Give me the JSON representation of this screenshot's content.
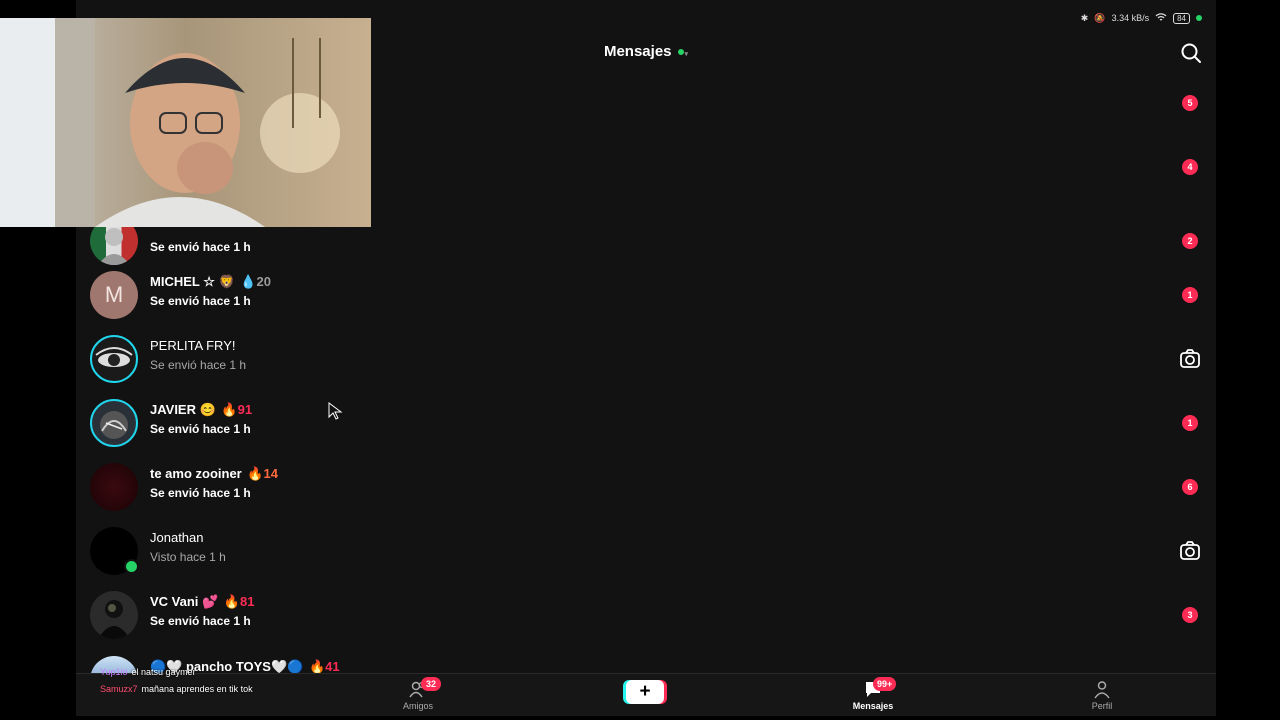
{
  "status_bar": {
    "speed": "3.34 kB/s",
    "battery": "84"
  },
  "header": {
    "title": "Mensajes"
  },
  "top_badges": [
    "5",
    "4",
    "2"
  ],
  "conversations": [
    {
      "name": "",
      "streak": "",
      "subtitle": "Se envió hace 1 h",
      "badge": ""
    },
    {
      "name": "MICHEL ☆ 🦁 ",
      "streak": "20",
      "subtitle": "Se envió hace 1 h",
      "badge": "1"
    },
    {
      "name": "PERLITA FRY!",
      "streak": "",
      "subtitle": "Se envió hace 1 h",
      "badge": ""
    },
    {
      "name": "JAVIER 😊 ",
      "streak": "91",
      "subtitle": "Se envió hace 1 h",
      "badge": "1"
    },
    {
      "name": "te amo zooiner ",
      "streak": "14",
      "subtitle": "Se envió hace 1 h",
      "badge": "6"
    },
    {
      "name": "Jonathan",
      "streak": "",
      "subtitle": "Visto hace 1 h",
      "badge": ""
    },
    {
      "name": "VC Vani 💕 ",
      "streak": "81",
      "subtitle": "Se envió hace 1 h",
      "badge": "3"
    },
    {
      "name": "🔵🤍 pancho TOYS🤍🔵 ",
      "streak": "41",
      "subtitle": "",
      "badge": ""
    }
  ],
  "avatar_letter": "M",
  "bottom_nav": {
    "friends_label": "Amigos",
    "friends_badge": "32",
    "messages_label": "Mensajes",
    "messages_badge": "99+",
    "profile_label": "Perfil",
    "create_label": "+"
  },
  "stream_chat": [
    {
      "user": "Yup1io",
      "message": "el natsu gaymer",
      "user_color": "#c57cff"
    },
    {
      "user": "Samuzx7",
      "message": "mañana aprendes en tik tok",
      "user_color": "#ff4b6e"
    }
  ],
  "colors": {
    "accent": "#fe2c55",
    "online": "#25d366",
    "story_ring": "#20d5ec",
    "background": "#121212"
  }
}
